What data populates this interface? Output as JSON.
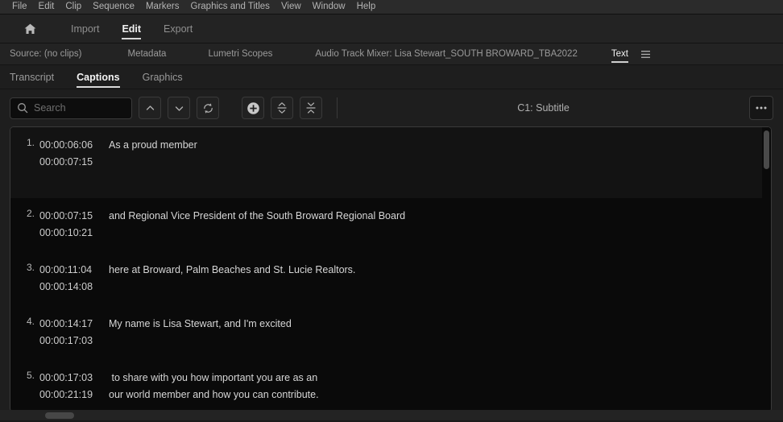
{
  "menubar": {
    "items": [
      {
        "label": "File"
      },
      {
        "label": "Edit"
      },
      {
        "label": "Clip"
      },
      {
        "label": "Sequence"
      },
      {
        "label": "Markers"
      },
      {
        "label": "Graphics and Titles"
      },
      {
        "label": "View"
      },
      {
        "label": "Window"
      },
      {
        "label": "Help"
      }
    ]
  },
  "workspace": {
    "home_icon": "home-icon",
    "tabs": [
      {
        "label": "Import",
        "active": false
      },
      {
        "label": "Edit",
        "active": true
      },
      {
        "label": "Export",
        "active": false
      }
    ]
  },
  "panel_tabs": {
    "items": [
      {
        "label": "Source: (no clips)",
        "active": false
      },
      {
        "label": "Metadata",
        "active": false
      },
      {
        "label": "Lumetri Scopes",
        "active": false
      },
      {
        "label": "Audio Track Mixer: Lisa Stewart_SOUTH BROWARD_TBA2022",
        "active": false
      },
      {
        "label": "Text",
        "active": true
      }
    ],
    "menu_icon": "hamburger-menu-icon"
  },
  "sub_tabs": {
    "items": [
      {
        "label": "Transcript",
        "active": false
      },
      {
        "label": "Captions",
        "active": true
      },
      {
        "label": "Graphics",
        "active": false
      }
    ]
  },
  "toolbar": {
    "search": {
      "icon": "search-icon",
      "value": "",
      "placeholder": "Search"
    },
    "prev_label": "",
    "next_label": "",
    "buttons": [
      {
        "name": "search-previous-button",
        "icon": "chevron-up-icon"
      },
      {
        "name": "search-next-button",
        "icon": "chevron-down-icon"
      },
      {
        "name": "refresh-captions-button",
        "icon": "refresh-icon"
      },
      {
        "name": "add-caption-button",
        "icon": "plus-circle-icon"
      },
      {
        "name": "split-caption-button",
        "icon": "split-icon"
      },
      {
        "name": "merge-caption-button",
        "icon": "merge-icon"
      }
    ],
    "track_label": "C1: Subtitle",
    "more_options_icon": "more-options-icon"
  },
  "captions": {
    "rows": [
      {
        "index": "1.",
        "start": "00:00:06:06",
        "end": "00:00:07:15",
        "text": "As a proud member",
        "selected": true
      },
      {
        "index": "2.",
        "start": "00:00:07:15",
        "end": "00:00:10:21",
        "text": "and Regional Vice President of the South Broward Regional Board",
        "selected": false
      },
      {
        "index": "3.",
        "start": "00:00:11:04",
        "end": "00:00:14:08",
        "text": "here at Broward, Palm Beaches and St. Lucie Realtors.",
        "selected": false
      },
      {
        "index": "4.",
        "start": "00:00:14:17",
        "end": "00:00:17:03",
        "text": "My name is Lisa Stewart, and I'm excited",
        "selected": false
      },
      {
        "index": "5.",
        "start": "00:00:17:03",
        "end": "00:00:21:19",
        "text": " to share with you how important you are as an\nour world member and how you can contribute.",
        "selected": false
      }
    ]
  },
  "colors": {
    "menubar_bg": "#2b2b2b",
    "panel_bg": "#1e1e1e",
    "list_bg": "#0a0a0a",
    "accent_underline": "#d8d8d8",
    "text_primary": "#d6d6d6",
    "text_muted": "#8f8f8f"
  }
}
